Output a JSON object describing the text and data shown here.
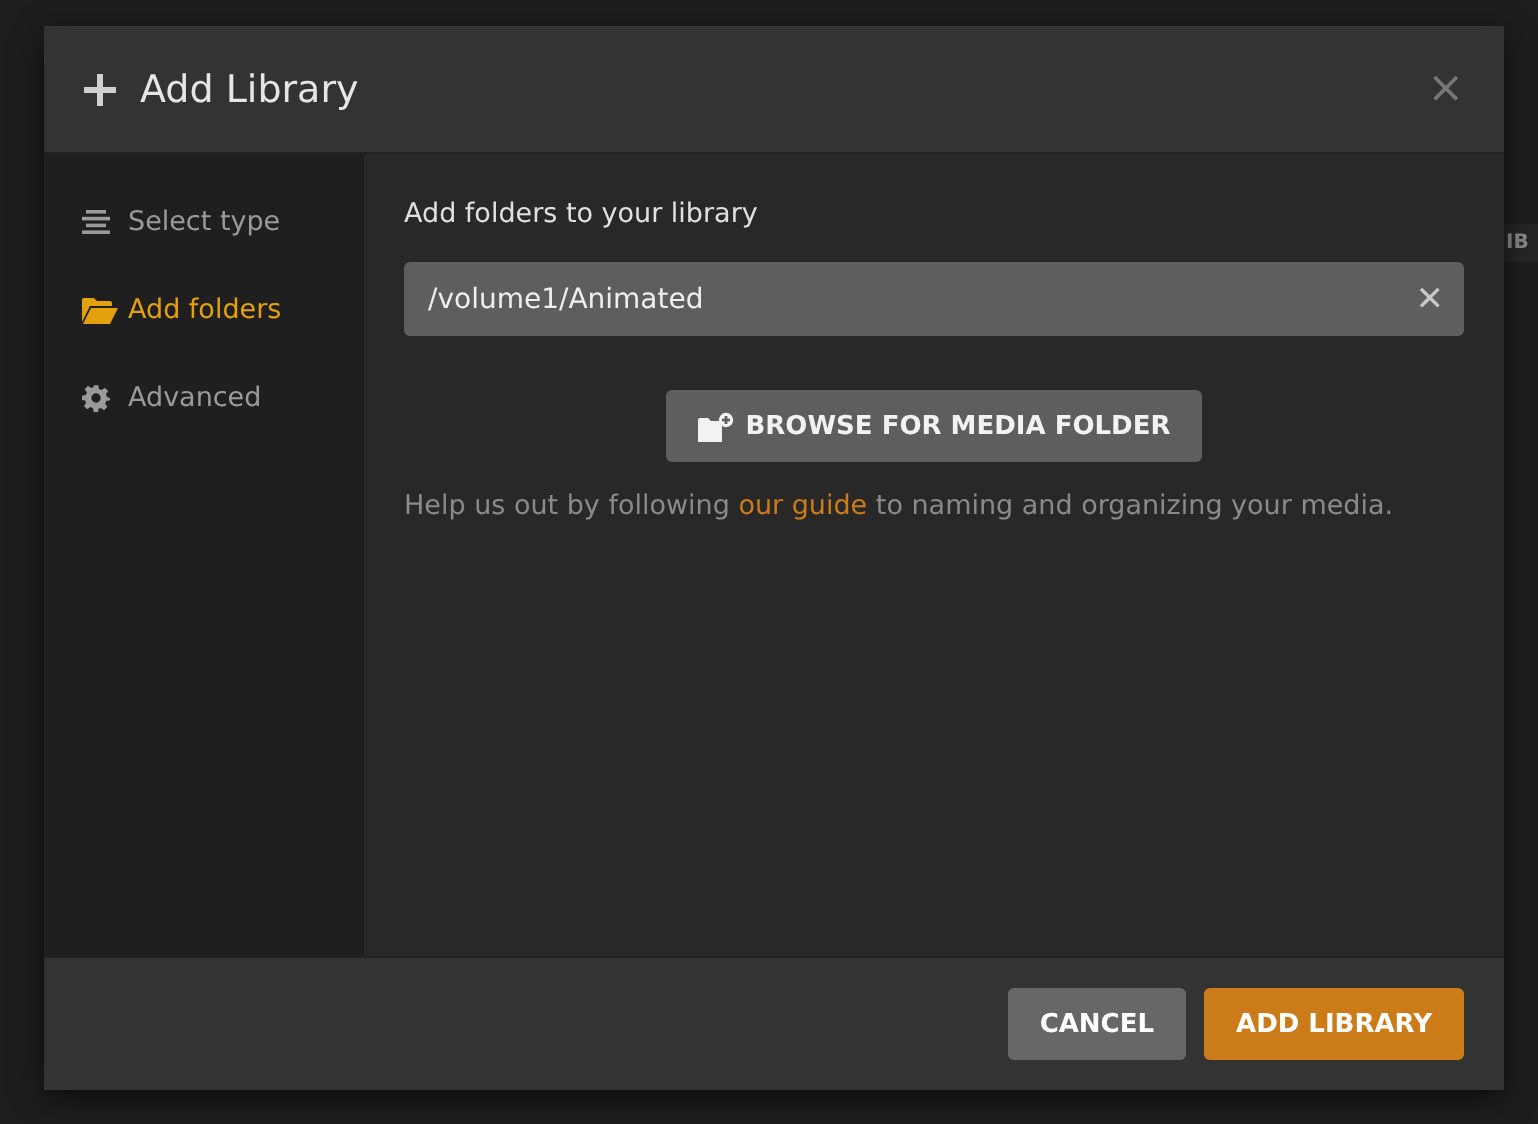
{
  "background": {
    "button_fragment": "IB"
  },
  "dialog": {
    "title": "Add Library",
    "close": "×"
  },
  "sidebar": {
    "items": [
      {
        "label": "Select type",
        "kind": "type",
        "selected": false
      },
      {
        "label": "Add folders",
        "kind": "folder",
        "selected": true
      },
      {
        "label": "Advanced",
        "kind": "gear",
        "selected": false
      }
    ]
  },
  "content": {
    "heading": "Add folders to your library",
    "folders": [
      {
        "value": "/volume1/Animated",
        "clear": "✕"
      }
    ],
    "browse_button": "BROWSE FOR MEDIA FOLDER",
    "help": {
      "before": "Help us out by following ",
      "link": "our guide",
      "after": " to naming and organizing your media."
    }
  },
  "buttons": [
    {
      "label": "CANCEL",
      "kind": "secondary"
    },
    {
      "label": "ADD LIBRARY",
      "kind": "primary"
    }
  ]
}
